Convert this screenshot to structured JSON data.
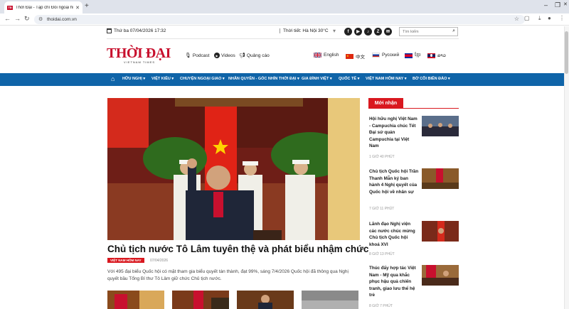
{
  "browser": {
    "tab_title": "Thời Đại - Tạp chí Đối ngoại hi",
    "favicon_text": "TĐ",
    "new_tab": "+",
    "url": "thoidai.com.vn"
  },
  "topbar": {
    "date": "Thứ ba 07/04/2026 17:32",
    "weather": "Thời tiết: Hà Nội 30°C",
    "search_placeholder": "Tìm kiếm",
    "social": [
      "f",
      "▶",
      "♪",
      "Z",
      "✉"
    ]
  },
  "logo": {
    "main": "THỜI ĐẠI",
    "sub": "VIETNAM TIMES"
  },
  "media": {
    "podcast": "Podcast",
    "videos": "Videos",
    "ads": "Quảng cáo"
  },
  "languages": [
    "English",
    "中文",
    "Русский",
    "ខ្មែរ",
    "ລາວ"
  ],
  "nav": [
    "HỮU NGHỊ ▾",
    "VIỆT KIỀU ▾",
    "CHUYỆN NGOẠI GIAO ▾",
    "NHÂN QUYỀN - GÓC NHÌN THỜI ĐẠI ▾",
    "GIA ĐÌNH VIỆT ▾",
    "QUỐC TẾ ▾",
    "VIỆT NAM HÔM NAY ▾",
    "BỜ CÕI BIÊN ĐẢO ▾"
  ],
  "hero": {
    "headline": "Chủ tịch nước Tô Lâm tuyên thệ và phát biểu nhậm chức",
    "category": "VIỆT NAM HÔM NAY",
    "date": "07/04/2026",
    "summary": "Với 495 đại biểu Quốc hội có mặt tham gia biểu quyết tán thành, đạt 99%, sáng 7/4/2026 Quốc hội đã thông qua Nghị quyết bầu Tổng Bí thư Tô Lâm giữ chức Chủ tịch nước."
  },
  "sidebar": {
    "title": "Mới nhận",
    "items": [
      {
        "title": "Hội hữu nghị Việt Nam - Campuchia chúc Tết Đại sứ quán Campuchia tại Việt Nam",
        "time": "1 GIỜ 40 PHÚT"
      },
      {
        "title": "Chủ tịch Quốc hội Trần Thanh Mẫn ký ban hành 4 Nghị quyết của Quốc hội về nhân sự",
        "time": "7 GIỜ 11 PHÚT"
      },
      {
        "title": "Lãnh đạo Nghị viện các nước chúc mừng Chủ tịch Quốc hội khoá XVI",
        "time": "8 GIỜ 13 PHÚT"
      },
      {
        "title": "Thúc đẩy hợp tác Việt Nam - Mỹ qua khắc phục hậu quả chiến tranh, giao lưu thể hệ trẻ",
        "time": "8 GIỜ 7 PHÚT"
      }
    ]
  },
  "colors": {
    "brand_red": "#c8102e",
    "nav_blue": "#0f64a8",
    "badge_red": "#d9181f"
  }
}
